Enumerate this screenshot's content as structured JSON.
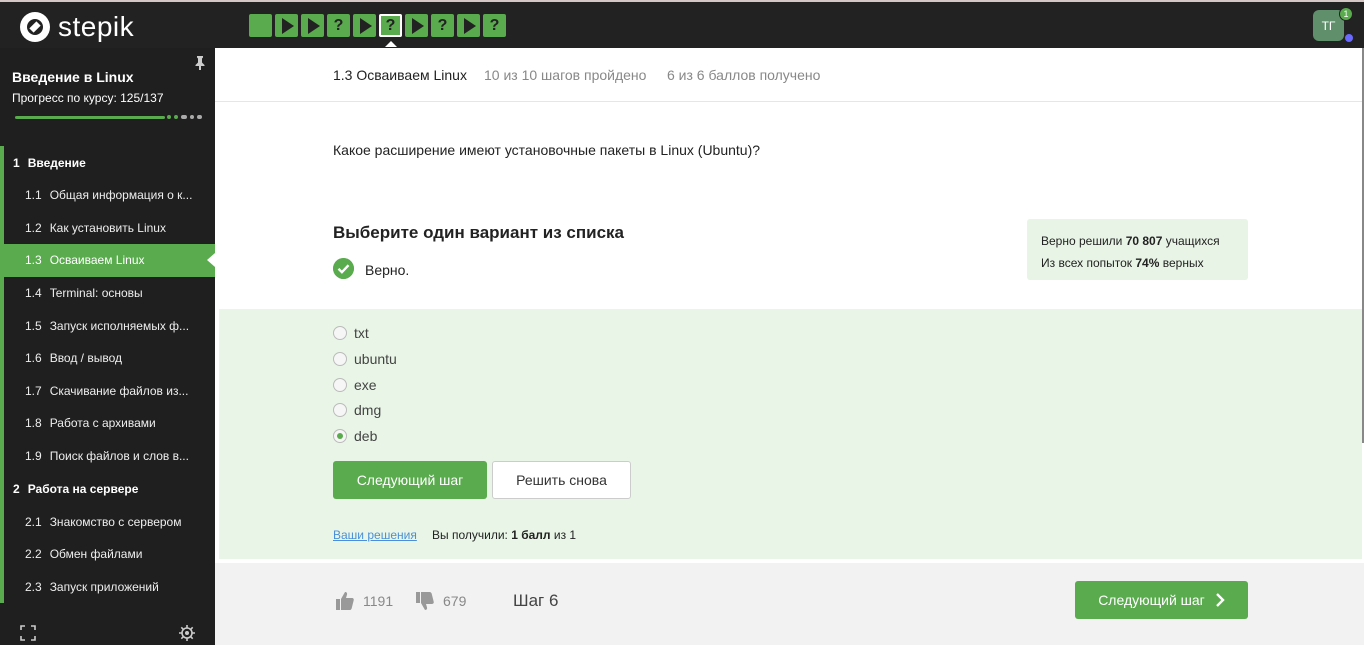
{
  "topbar": {
    "logo_text": "stepik",
    "steps": [
      {
        "type": "text",
        "glyph": ""
      },
      {
        "type": "play",
        "glyph": ""
      },
      {
        "type": "play",
        "glyph": ""
      },
      {
        "type": "quiz",
        "glyph": "?"
      },
      {
        "type": "play",
        "glyph": ""
      },
      {
        "type": "quiz",
        "glyph": "?",
        "current": true
      },
      {
        "type": "play",
        "glyph": ""
      },
      {
        "type": "quiz",
        "glyph": "?"
      },
      {
        "type": "play",
        "glyph": ""
      },
      {
        "type": "quiz",
        "glyph": "?"
      }
    ],
    "avatar_initials": "ТГ",
    "notification_count": "1"
  },
  "sidebar": {
    "course_title": "Введение в Linux",
    "progress_label": "Прогресс по курсу:  125/137",
    "progress": {
      "done": 125,
      "total": 137
    },
    "items": [
      {
        "kind": "section",
        "num": "1",
        "label": "Введение"
      },
      {
        "kind": "lesson",
        "num": "1.1",
        "label": "Общая информация о к..."
      },
      {
        "kind": "lesson",
        "num": "1.2",
        "label": "Как установить Linux"
      },
      {
        "kind": "lesson",
        "num": "1.3",
        "label": "Осваиваем Linux",
        "active": true
      },
      {
        "kind": "lesson",
        "num": "1.4",
        "label": "Terminal: основы"
      },
      {
        "kind": "lesson",
        "num": "1.5",
        "label": "Запуск исполняемых ф..."
      },
      {
        "kind": "lesson",
        "num": "1.6",
        "label": "Ввод / вывод"
      },
      {
        "kind": "lesson",
        "num": "1.7",
        "label": "Скачивание файлов из..."
      },
      {
        "kind": "lesson",
        "num": "1.8",
        "label": "Работа с архивами"
      },
      {
        "kind": "lesson",
        "num": "1.9",
        "label": "Поиск файлов и слов в..."
      },
      {
        "kind": "section",
        "num": "2",
        "label": "Работа на сервере"
      },
      {
        "kind": "lesson",
        "num": "2.1",
        "label": "Знакомство с сервером"
      },
      {
        "kind": "lesson",
        "num": "2.2",
        "label": "Обмен файлами"
      },
      {
        "kind": "lesson",
        "num": "2.3",
        "label": "Запуск приложений"
      }
    ]
  },
  "lesson": {
    "title": "1.3 Осваиваем Linux",
    "steps_done": "10 из 10 шагов пройдено",
    "points": "6 из 6 баллов  получено"
  },
  "quiz": {
    "question": "Какое расширение имеют установочные пакеты в Linux (Ubuntu)?",
    "title": "Выберите один вариант из списка",
    "verdict": "Верно.",
    "stats": {
      "solved_prefix": "Верно решили ",
      "solved_count": "70 807",
      "solved_suffix": " учащихся",
      "attempts_prefix": "Из всех попыток ",
      "attempts_percent": "74%",
      "attempts_suffix": " верных"
    },
    "options": [
      {
        "label": "txt",
        "checked": false
      },
      {
        "label": "ubuntu",
        "checked": false
      },
      {
        "label": "exe",
        "checked": false
      },
      {
        "label": "dmg",
        "checked": false
      },
      {
        "label": "deb",
        "checked": true
      }
    ],
    "next_button": "Следующий шаг",
    "retry_button": "Решить снова",
    "solutions_link": "Ваши решения",
    "score_prefix": "Вы получили: ",
    "score_value": "1 балл",
    "score_suffix": " из 1"
  },
  "footer": {
    "likes": "1191",
    "dislikes": "679",
    "step_label": "Шаг 6",
    "next_button": "Следующий шаг"
  },
  "colors": {
    "accent": "#5aaa4e",
    "topbar": "#222222",
    "sidebar": "#1f1f1f",
    "answer_bg": "#e9f6e7"
  }
}
